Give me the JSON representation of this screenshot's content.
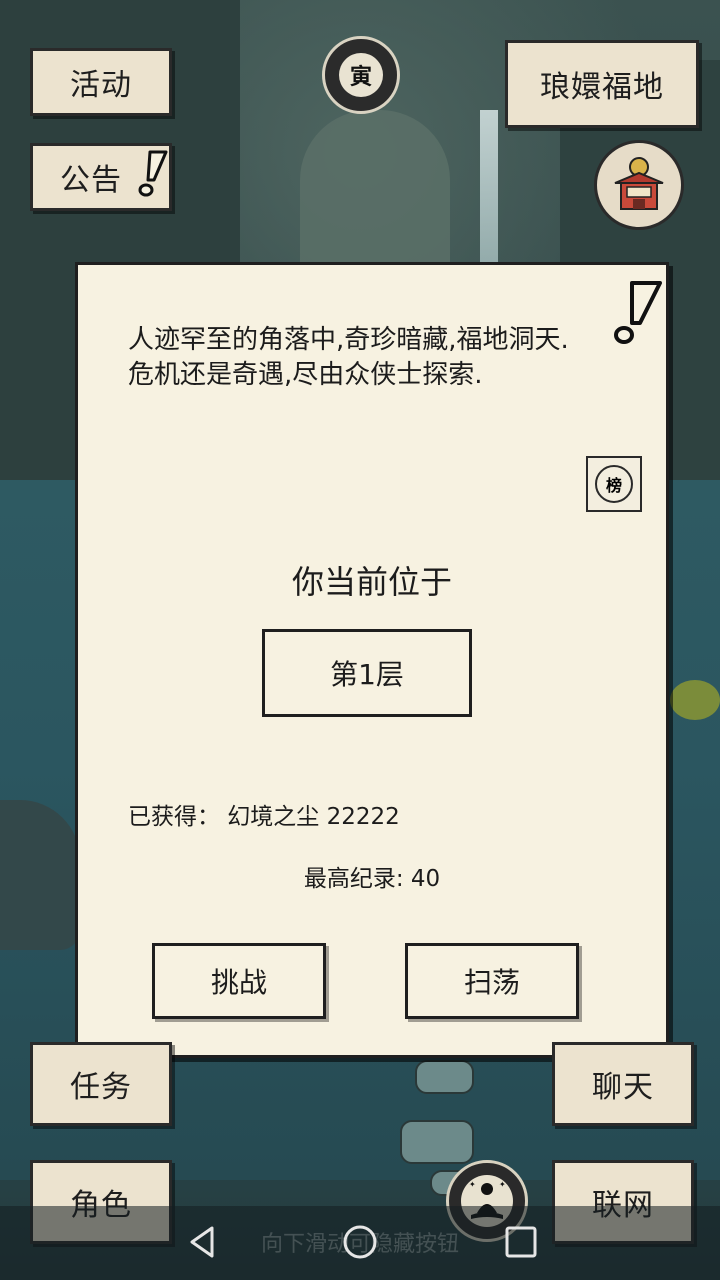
{
  "top_left": {
    "activity": "活动",
    "notice": "公告"
  },
  "top_center": {
    "zodiac_glyph": "寅"
  },
  "top_right": {
    "location": "琅嬛福地",
    "shop_sign": "杂货",
    "shop_top_glyph": "令"
  },
  "dialog": {
    "description": "人迹罕至的角落中,奇珍暗藏,福地洞天.危机还是奇遇,尽由众侠士探索.",
    "rank_glyph": "榜",
    "current_label": "你当前位于",
    "floor": "第1层",
    "obtained": "已获得：  幻境之尘 22222",
    "record": "最高纪录: 40",
    "challenge": "挑战",
    "sweep": "扫荡"
  },
  "bottom_left": {
    "task": "任务",
    "role": "角色"
  },
  "bottom_right": {
    "chat": "聊天",
    "network": "联网"
  },
  "navbar": {
    "hint": "向下滑动可隐藏按钮"
  },
  "colors": {
    "panel": "#f7f2e1",
    "button": "#ece3cf",
    "ink": "#1c1c1c"
  }
}
